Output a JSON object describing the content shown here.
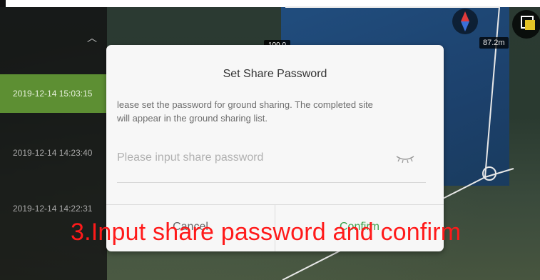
{
  "history": {
    "rows": [
      {
        "time": "2019-12-14 15:03:15",
        "active": true
      },
      {
        "time": "2019-12-14 14:23:40",
        "active": false
      },
      {
        "time": "2019-12-14 14:22:31",
        "active": false
      }
    ],
    "collapse_icon": "chevron-up-icon"
  },
  "map": {
    "distance_label": "87.2m",
    "top_badge": "100.0",
    "compass_icon": "compass-icon",
    "layers_icon": "layers-icon",
    "accent_color": "#e3c326"
  },
  "dialog": {
    "title": "Set Share Password",
    "message_line1": "lease set the password for ground sharing. The completed site",
    "message_line2": "will appear in the ground sharing list.",
    "input_placeholder": "Please input share password",
    "input_value": "",
    "visibility_icon": "eye-closed-icon",
    "cancel_label": "Cancel",
    "confirm_label": "Confirm",
    "confirm_color": "#3fa34d"
  },
  "caption": {
    "text": "3.Input share password and confirm",
    "color": "#ff1a1a"
  }
}
